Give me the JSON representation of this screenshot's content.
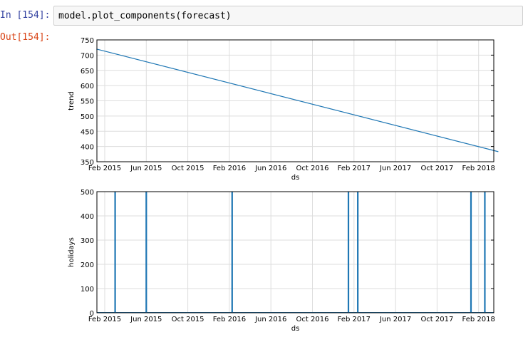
{
  "cell": {
    "in_prompt": "In [154]:",
    "code": "model.plot_components(forecast)",
    "out_prompt": "Out[154]:"
  },
  "chart_data": [
    {
      "type": "line",
      "xlabel": "ds",
      "ylabel": "trend",
      "ylim": [
        350,
        750
      ],
      "yticks": [
        "350",
        "400",
        "450",
        "500",
        "550",
        "600",
        "650",
        "700",
        "750"
      ],
      "xticks": [
        "Feb 2015",
        "Jun 2015",
        "Oct 2015",
        "Feb 2016",
        "Jun 2016",
        "Oct 2016",
        "Feb 2017",
        "Jun 2017",
        "Oct 2017",
        "Feb 2018"
      ],
      "grid": true,
      "color": "#1f77b4",
      "x": [
        "2015-01-08",
        "2018-03-14"
      ],
      "y": [
        720,
        383
      ]
    },
    {
      "type": "line",
      "xlabel": "ds",
      "ylabel": "holidays",
      "ylim": [
        0,
        500
      ],
      "yticks": [
        "0",
        "100",
        "200",
        "300",
        "400",
        "500"
      ],
      "xticks": [
        "Feb 2015",
        "Jun 2015",
        "Oct 2015",
        "Feb 2016",
        "Jun 2016",
        "Oct 2016",
        "Feb 2017",
        "Jun 2017",
        "Oct 2017",
        "Feb 2018"
      ],
      "grid": true,
      "color": "#1f77b4",
      "spikes_x": [
        "2015-03-03",
        "2015-06-01",
        "2016-02-04",
        "2017-01-05",
        "2017-02-01",
        "2017-12-25",
        "2018-02-03"
      ],
      "spike_value": 500
    }
  ]
}
